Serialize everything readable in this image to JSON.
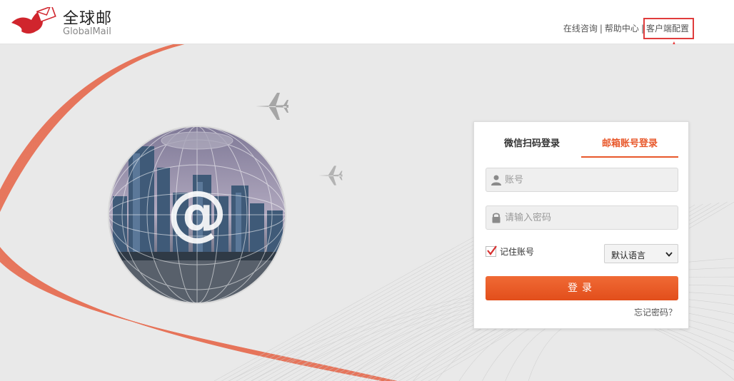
{
  "header": {
    "logo_cn": "全球邮",
    "logo_en": "GlobalMail",
    "nav": [
      {
        "label": "在线咨询"
      },
      {
        "label": "帮助中心"
      },
      {
        "label": "客户端配置"
      }
    ],
    "separator": "|"
  },
  "banner": {
    "globe_symbol": "@"
  },
  "login": {
    "tabs": [
      {
        "label": "微信扫码登录",
        "active": false
      },
      {
        "label": "邮箱账号登录",
        "active": true
      }
    ],
    "username_placeholder": "账号",
    "password_placeholder": "请输入密码",
    "remember_label": "记住账号",
    "remember_checked": true,
    "language_selected": "默认语言",
    "submit_label": "登录",
    "forgot_label": "忘记密码？"
  },
  "colors": {
    "accent": "#e8582b",
    "highlight": "#e03c3c",
    "wave": "#e6502e"
  },
  "icons": [
    "logo-bird-icon",
    "user-icon",
    "lock-icon",
    "check-icon",
    "chevron-down-icon",
    "plane-icon",
    "arrow-icon"
  ]
}
